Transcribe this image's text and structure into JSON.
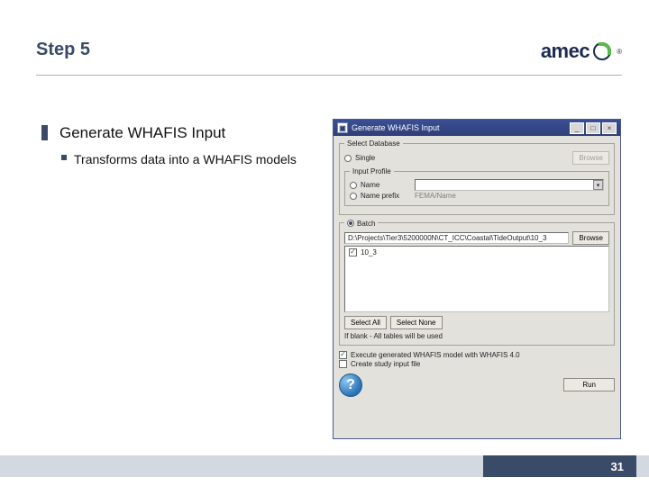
{
  "slide": {
    "title": "Step 5",
    "logo_text": "amec",
    "logo_trademark": "®",
    "page_number": "31"
  },
  "bullets": {
    "main": "Generate WHAFIS Input",
    "sub": "Transforms data into a WHAFIS models"
  },
  "dialog": {
    "title": "Generate WHAFIS Input",
    "group_database": "Select Database",
    "radio_single": "Single",
    "btn_browse_top": "Browse",
    "group_profile": "Input Profile",
    "radio_name": "Name",
    "radio_name_prefix": "Name prefix",
    "prefix_hint": "FEMA/Name",
    "group_batch": "Batch",
    "path_value": "D:\\Projects\\Tier3\\5200000N\\CT_ICC\\Coastal\\TideOutput\\10_3",
    "btn_browse": "Browse",
    "list_item": "10_3",
    "btn_select_all": "Select All",
    "btn_select_none": "Select None",
    "note": "If blank - All tables will be used",
    "chk_execute": "Execute generated WHAFIS model with WHAFIS 4.0",
    "chk_create": "Create study input file",
    "btn_run": "Run"
  }
}
